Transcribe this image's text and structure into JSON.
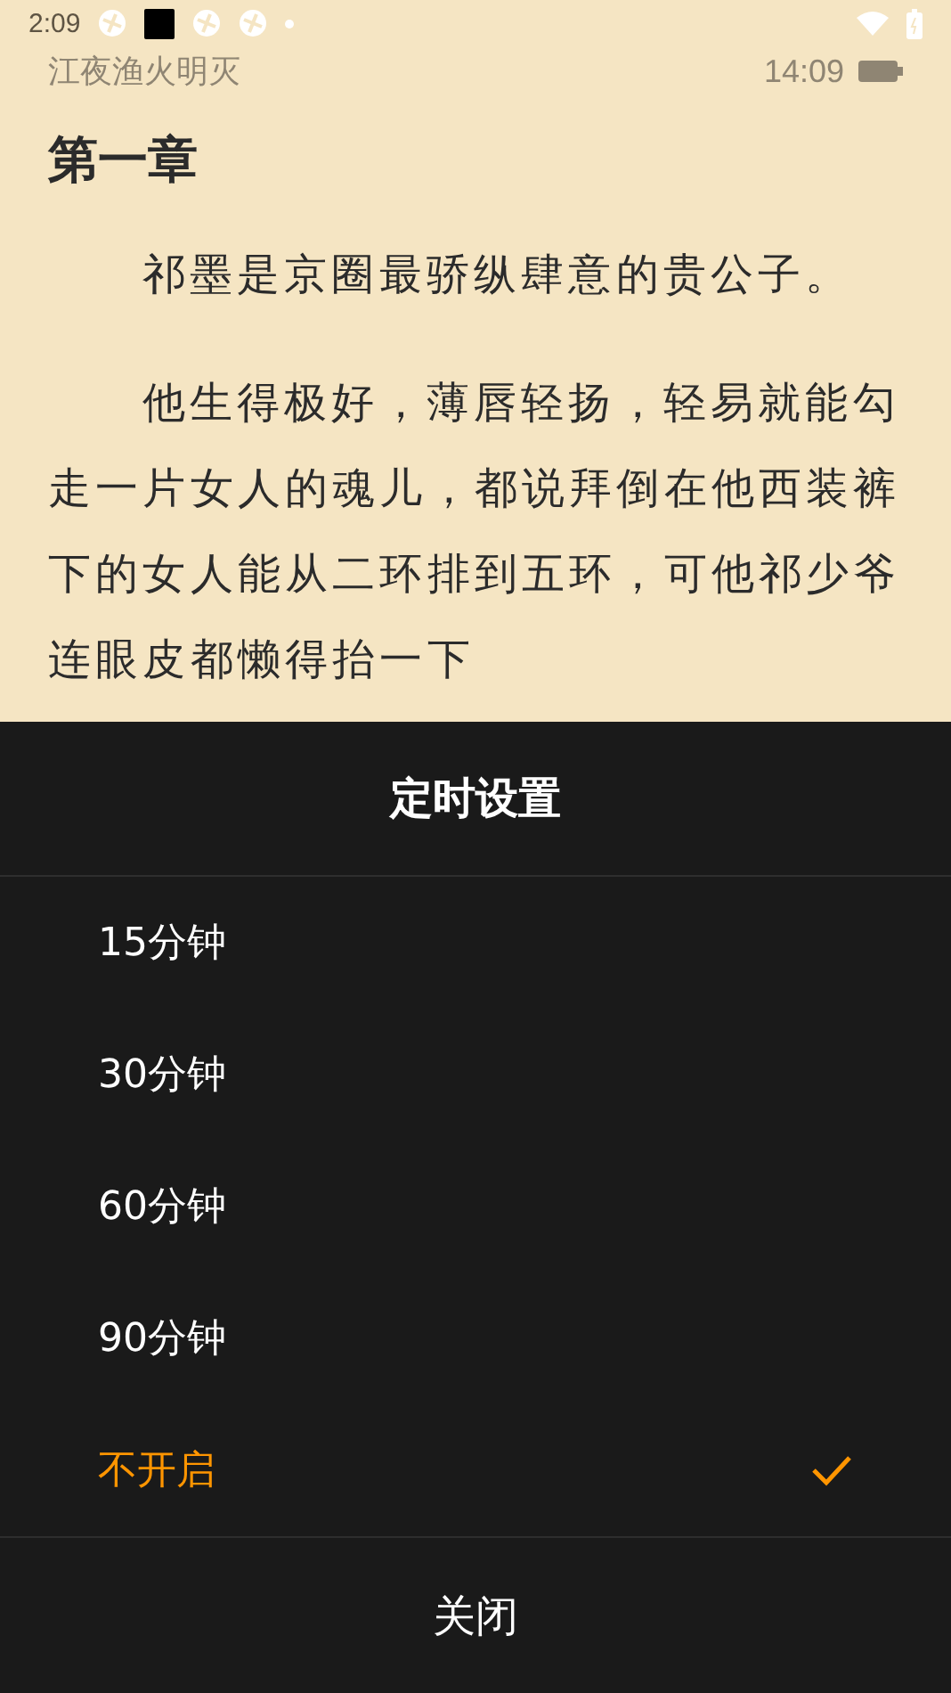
{
  "status_bar": {
    "time": "2:09"
  },
  "reader_header": {
    "book_title": "江夜渔火明灭",
    "clock": "14:09"
  },
  "chapter": {
    "title": "第一章",
    "paragraphs": [
      "祁墨是京圈最骄纵肆意的贵公子。",
      "他生得极好，薄唇轻扬，轻易就能勾走一片女人的魂儿，都说拜倒在他西装裤下的女人能从二环排到五环，可他祁少爷连眼皮都懒得抬一下"
    ]
  },
  "timer_sheet": {
    "title": "定时设置",
    "options": [
      {
        "label": "15分钟",
        "selected": false
      },
      {
        "label": "30分钟",
        "selected": false
      },
      {
        "label": "60分钟",
        "selected": false
      },
      {
        "label": "90分钟",
        "selected": false
      },
      {
        "label": "不开启",
        "selected": true
      }
    ],
    "close_button": "关闭"
  }
}
